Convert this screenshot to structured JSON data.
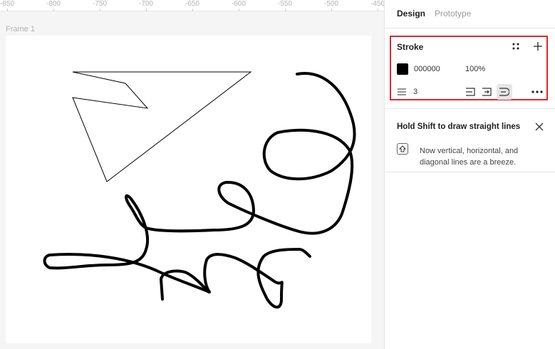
{
  "ruler": {
    "ticks": [
      "-850",
      "-800",
      "-750",
      "-700",
      "-650",
      "-600",
      "-550",
      "-500",
      "-450"
    ]
  },
  "canvas": {
    "frame_label": "Frame 1"
  },
  "panel": {
    "tabs": [
      {
        "label": "Design"
      },
      {
        "label": "Prototype"
      }
    ],
    "stroke": {
      "title": "Stroke",
      "color_hex": "000000",
      "color": "#000000",
      "opacity": "100%",
      "weight": "3"
    },
    "hint": {
      "title": "Hold Shift to draw straight lines",
      "body": "Now vertical, horizontal, and diagonal lines are a breeze."
    }
  },
  "colors": {
    "highlight": "#e3262b",
    "accent_ink": "#000000"
  }
}
